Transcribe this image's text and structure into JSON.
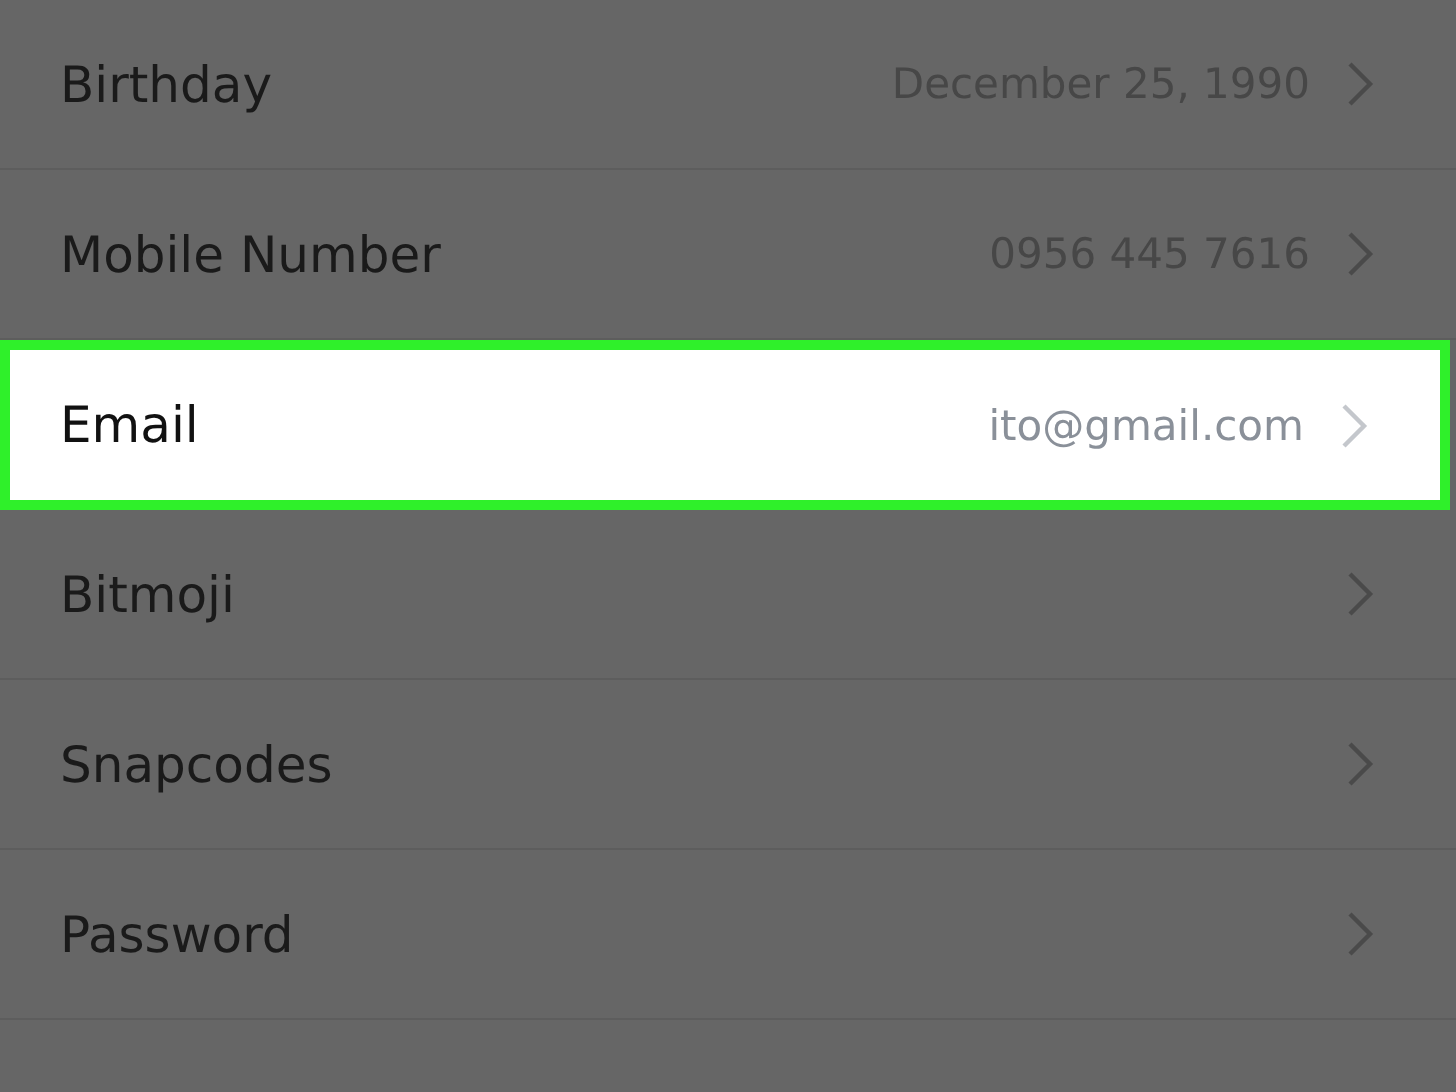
{
  "settings": [
    {
      "label": "Birthday",
      "value": "December 25, 1990",
      "highlighted": false
    },
    {
      "label": "Mobile Number",
      "value": "0956 445 7616",
      "highlighted": false
    },
    {
      "label": "Email",
      "value": "ito@gmail.com",
      "highlighted": true
    },
    {
      "label": "Bitmoji",
      "highlighted": false
    },
    {
      "label": "Snapcodes",
      "highlighted": false
    },
    {
      "label": "Password",
      "highlighted": false
    }
  ]
}
